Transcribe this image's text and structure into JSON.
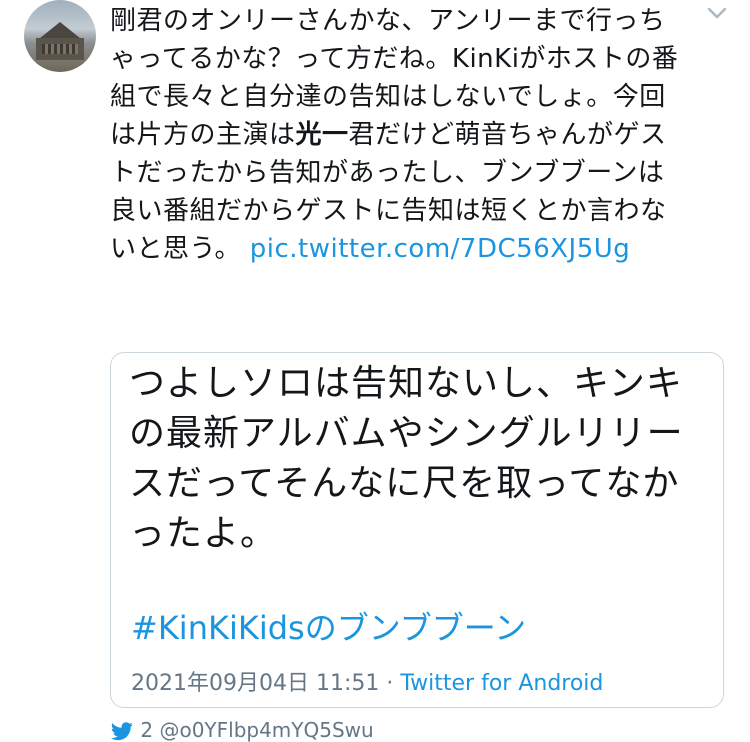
{
  "tweet": {
    "text_part1": "剛君のオンリーさんかな、アンリーまで行っちゃってるかな？って方だね。KinKiがホストの番組で長々と自分達の告知はしないでしょ。今回は片方の主演は",
    "text_bold": "光一",
    "text_part2": "君だけど萌音ちゃんがゲストだったから告知があったし、ブンブブーンは良い番組だからゲストに告知は短くとか言わないと思う。 ",
    "link": "pic.twitter.com/7DC56XJ5Ug"
  },
  "quote": {
    "text": "つよしソロは告知ないし、キンキの最新アルバムやシングルリリースだってそんなに尺を取ってなかったよ。",
    "hashtag": "#KinKiKidsのブンブブーン",
    "timestamp": "2021年09月04日 11:51",
    "separator": " · ",
    "source": "Twitter for Android"
  },
  "footer": {
    "count": "2",
    "handle": "@o0YFlbp4mYQ5Swu"
  },
  "icons": {
    "menu": "chevron-down-icon",
    "bird": "twitter-bird-icon"
  },
  "colors": {
    "link": "#1b95e0",
    "meta": "#657786",
    "border": "#ccd6dd"
  }
}
